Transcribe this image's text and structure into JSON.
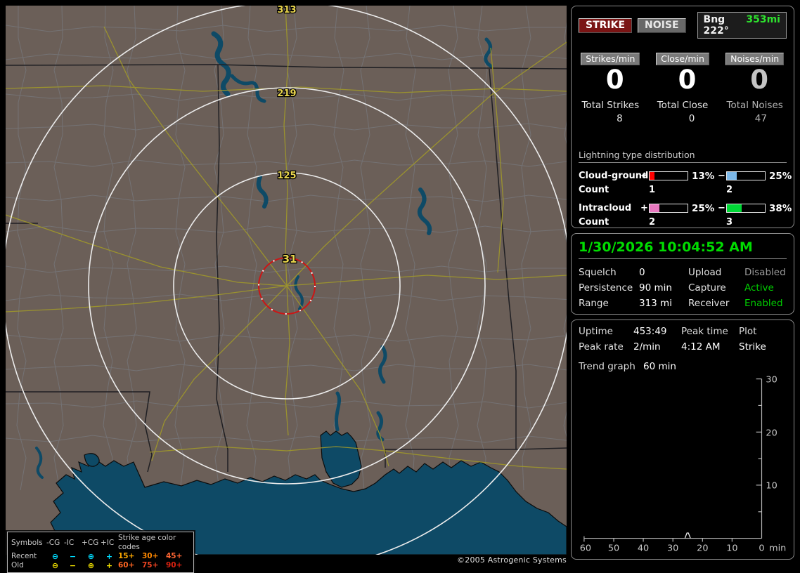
{
  "map": {
    "ring_labels": {
      "r313": "313",
      "r219": "219",
      "r125": "125",
      "r31": "31"
    },
    "copyright": "©2005 Astrogenic Systems",
    "legend": {
      "symbols_header": "Symbols",
      "type_headers": [
        "-CG",
        "-IC",
        "+CG",
        "+IC"
      ],
      "age_header": "Strike age color codes",
      "recent_label": "Recent",
      "old_label": "Old",
      "recent_symbols": [
        "⊖",
        "−",
        "⊕",
        "+"
      ],
      "old_symbols": [
        "⊖",
        "−",
        "⊕",
        "+"
      ],
      "recent_ages": [
        "15+",
        "30+",
        "45+"
      ],
      "old_ages": [
        "60+",
        "75+",
        "90+"
      ],
      "recent_symbol_color": "#00dcff",
      "old_symbol_color": "#f0e000",
      "age_colors": [
        "#ffaa00",
        "#ff8800",
        "#ff6633",
        "#ff6622",
        "#ee4422",
        "#dd2211"
      ]
    }
  },
  "strike_panel": {
    "strike_button": "STRIKE",
    "noise_button": "NOISE",
    "bearing": "Bng 222°",
    "distance": "353mi",
    "columns": [
      {
        "chip": "Strikes/min",
        "rate": "0",
        "total_label": "Total Strikes",
        "total": "8"
      },
      {
        "chip": "Close/min",
        "rate": "0",
        "total_label": "Total Close",
        "total": "0"
      },
      {
        "chip": "Noises/min",
        "rate": "0",
        "total_label": "Total Noises",
        "total": "47"
      }
    ],
    "distribution": {
      "header": "Lightning type distribution",
      "count_label": "Count",
      "rows": [
        {
          "label": "Cloud-ground",
          "plus_sign": "+",
          "minus_sign": "−",
          "pos_pct": "13%",
          "neg_pct": "25%",
          "pos_width": "13%",
          "neg_width": "25%",
          "pos_color": "#ff0000",
          "neg_color": "#7cb8e8",
          "pos_count": "1",
          "neg_count": "2"
        },
        {
          "label": "Intracloud",
          "plus_sign": "+",
          "minus_sign": "−",
          "pos_pct": "25%",
          "neg_pct": "38%",
          "pos_width": "25%",
          "neg_width": "38%",
          "pos_color": "#e878c0",
          "neg_color": "#00d836",
          "pos_count": "2",
          "neg_count": "3"
        }
      ]
    }
  },
  "status_panel": {
    "datetime": "1/30/2026 10:04:52 AM",
    "rows_left": [
      {
        "label": "Squelch",
        "value": "0"
      },
      {
        "label": "Persistence",
        "value": "90 min"
      },
      {
        "label": "Range",
        "value": "313 mi"
      }
    ],
    "rows_right": [
      {
        "label": "Upload",
        "value": "Disabled",
        "color": "#9a9a9a"
      },
      {
        "label": "Capture",
        "value": "Active",
        "color": "#00cc00"
      },
      {
        "label": "Receiver",
        "value": "Enabled",
        "color": "#00cc00"
      }
    ]
  },
  "trend_panel": {
    "uptime_label": "Uptime",
    "uptime": "453:49",
    "peaktime_label": "Peak time",
    "plot_label": "Plot",
    "peakrate_label": "Peak rate",
    "peakrate": "2/min",
    "peaktime": "4:12 AM",
    "plot": "Strike",
    "trend_label": "Trend graph",
    "trend_window": "60 min"
  },
  "chart_data": {
    "type": "line",
    "title": "Strike rate trend, last 60 minutes",
    "xlabel": "min",
    "ylabel": "",
    "x_ticks": [
      "60",
      "50",
      "40",
      "30",
      "20",
      "10",
      "0"
    ],
    "x_unit": "min",
    "y_ticks": [
      "30",
      "20",
      "10"
    ],
    "xlim_minutes_ago": [
      60,
      0
    ],
    "ylim": [
      0,
      30
    ],
    "legend_position": "none",
    "grid": false,
    "series": [
      {
        "name": "Strike",
        "baseline_value": 0,
        "points": [
          {
            "min_ago": 25,
            "value": 1
          }
        ]
      }
    ]
  }
}
